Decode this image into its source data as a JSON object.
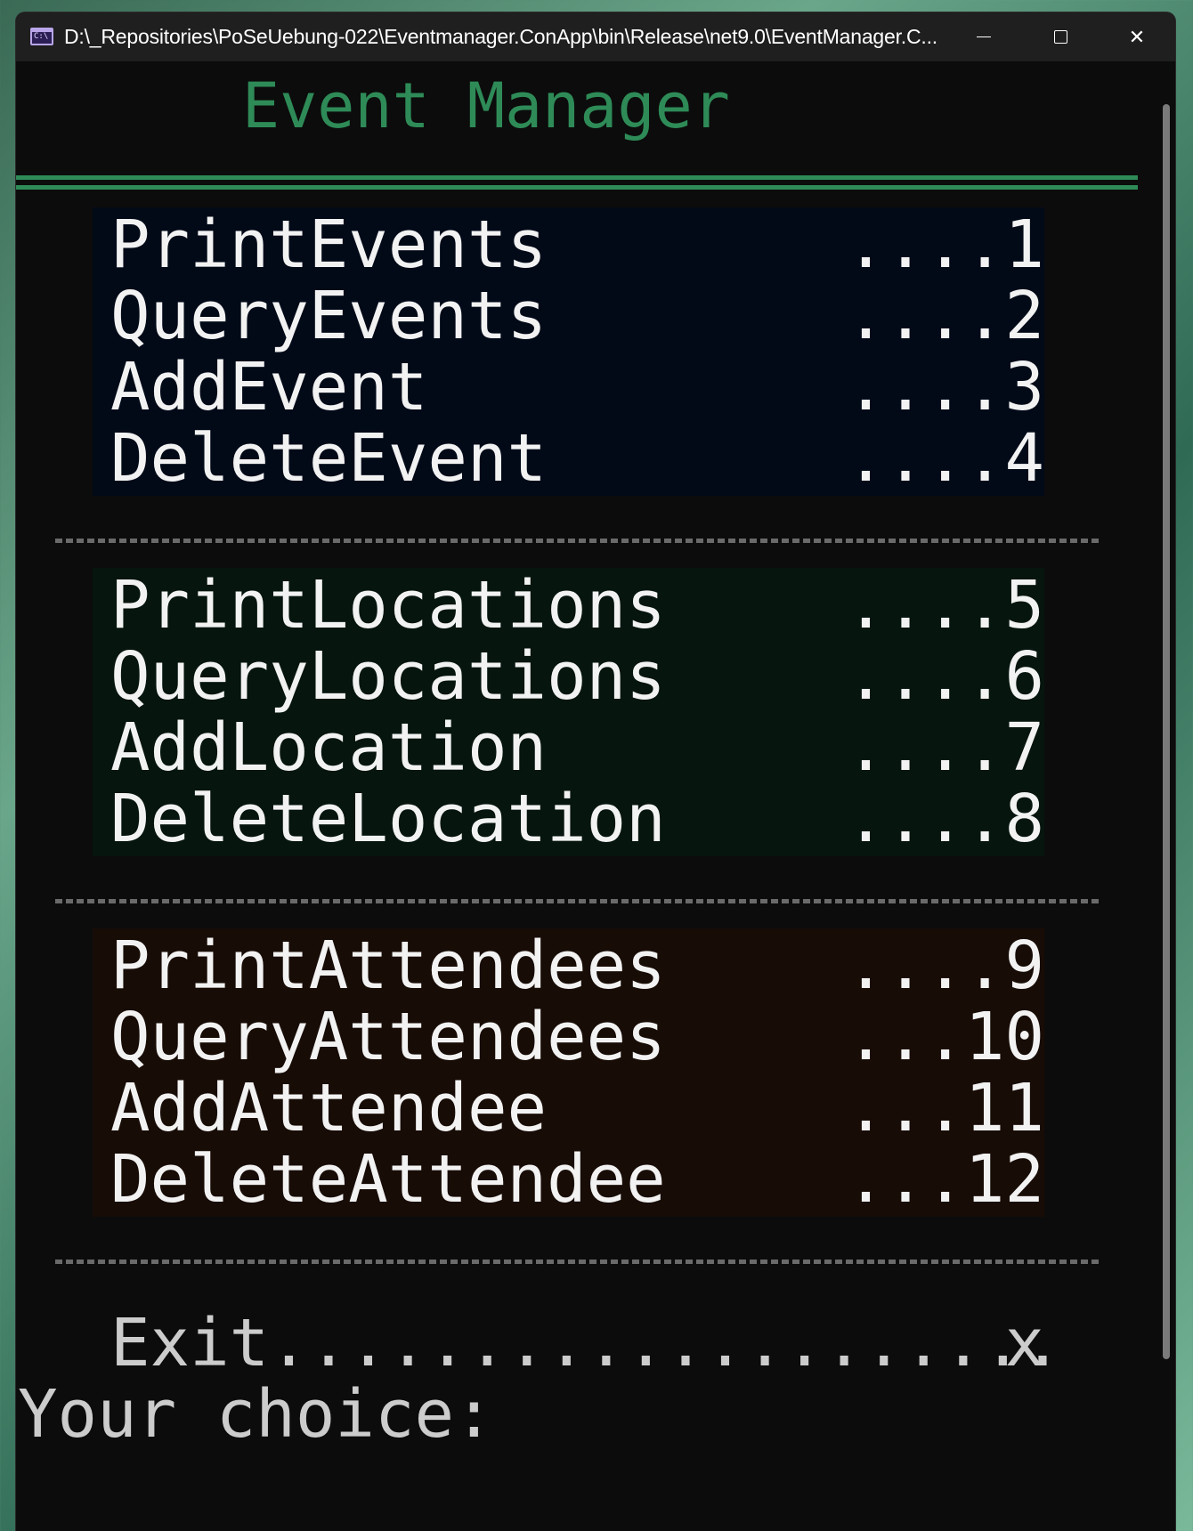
{
  "window": {
    "title": "D:\\_Repositories\\PoSeUebung-022\\Eventmanager.ConApp\\bin\\Release\\net9.0\\EventManager.C...",
    "icon": "console-app-icon",
    "icon_text": "C:\\",
    "controls": {
      "minimize_icon": "minimize-icon",
      "maximize_icon": "maximize-icon",
      "close_icon": "close-icon",
      "close_glyph": "✕"
    }
  },
  "console": {
    "heading": "Event Manager",
    "accent_color": "#2e8b57",
    "groups": [
      {
        "name": "events",
        "background": "#020a18",
        "items": [
          {
            "label": "PrintEvents",
            "key": "....1"
          },
          {
            "label": "QueryEvents",
            "key": "....2"
          },
          {
            "label": "AddEvent",
            "key": "....3"
          },
          {
            "label": "DeleteEvent",
            "key": "....4"
          }
        ]
      },
      {
        "name": "locations",
        "background": "#06150e",
        "items": [
          {
            "label": "PrintLocations",
            "key": "....5"
          },
          {
            "label": "QueryLocations",
            "key": "....6"
          },
          {
            "label": "AddLocation",
            "key": "....7"
          },
          {
            "label": "DeleteLocation",
            "key": "....8"
          }
        ]
      },
      {
        "name": "attendees",
        "background": "#180c06",
        "items": [
          {
            "label": "PrintAttendees",
            "key": "....9"
          },
          {
            "label": "QueryAttendees",
            "key": "...10"
          },
          {
            "label": "AddAttendee",
            "key": "...11"
          },
          {
            "label": "DeleteAttendee",
            "key": "...12"
          }
        ]
      }
    ],
    "exit": {
      "label": "Exit....................",
      "key": "x"
    },
    "prompt": "Your choice:"
  }
}
